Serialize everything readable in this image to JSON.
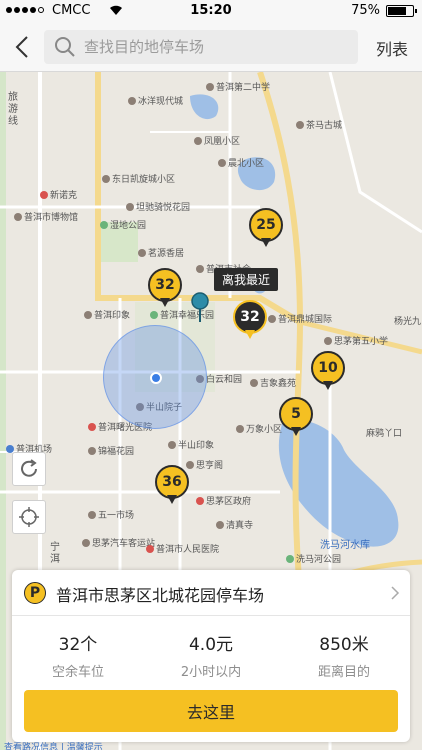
{
  "status_bar": {
    "carrier": "CMCC",
    "time": "15:20",
    "battery_percent": "75%",
    "battery_level": 0.75,
    "signal_bars": 4
  },
  "nav": {
    "search_placeholder": "查找目的地停车场",
    "list_label": "列表"
  },
  "map": {
    "road_labels": {
      "lvyou": "旅游线",
      "ning": "宁洱"
    },
    "pois": [
      {
        "name": "普洱第二中学",
        "kind": "school"
      },
      {
        "name": "冰洋现代城",
        "kind": "place"
      },
      {
        "name": "茶马古城",
        "kind": "place"
      },
      {
        "name": "凤凰小区",
        "kind": "place"
      },
      {
        "name": "晨北小区",
        "kind": "place"
      },
      {
        "name": "东日凯旋城小区",
        "kind": "place"
      },
      {
        "name": "新诺克",
        "kind": "place"
      },
      {
        "name": "坦驰骑悦花园",
        "kind": "place"
      },
      {
        "name": "普洱市博物馆",
        "kind": "place"
      },
      {
        "name": "湿地公园",
        "kind": "park"
      },
      {
        "name": "茗源香居",
        "kind": "place"
      },
      {
        "name": "普洱市社会",
        "kind": "place"
      },
      {
        "name": "普洱印象",
        "kind": "place"
      },
      {
        "name": "普洱幸福乐园",
        "kind": "park"
      },
      {
        "name": "普洱鼎城国际",
        "kind": "place"
      },
      {
        "name": "思茅第五小学",
        "kind": "school"
      },
      {
        "name": "杨光九",
        "kind": "place"
      },
      {
        "name": "白云和园",
        "kind": "place"
      },
      {
        "name": "吉象鑫苑",
        "kind": "place"
      },
      {
        "name": "半山院子",
        "kind": "place"
      },
      {
        "name": "万象小区",
        "kind": "place"
      },
      {
        "name": "麻鸦丫口",
        "kind": "road"
      },
      {
        "name": "普洱机场",
        "kind": "airport"
      },
      {
        "name": "普洱曙光医院",
        "kind": "hospital"
      },
      {
        "name": "半山印象",
        "kind": "place"
      },
      {
        "name": "锦福花园",
        "kind": "place"
      },
      {
        "name": "思亨阁",
        "kind": "place"
      },
      {
        "name": "思茅区政府",
        "kind": "gov"
      },
      {
        "name": "清真寺",
        "kind": "place"
      },
      {
        "name": "五一市场",
        "kind": "place"
      },
      {
        "name": "思茅汽车客运站",
        "kind": "place"
      },
      {
        "name": "普洱市人民医院",
        "kind": "hospital"
      },
      {
        "name": "洗马河水库",
        "kind": "water"
      },
      {
        "name": "洗马河公园",
        "kind": "park"
      }
    ],
    "markers": [
      {
        "count": "25",
        "selected": false
      },
      {
        "count": "32",
        "selected": false
      },
      {
        "count": "32",
        "selected": true
      },
      {
        "count": "10",
        "selected": false
      },
      {
        "count": "5",
        "selected": false
      },
      {
        "count": "36",
        "selected": false
      }
    ],
    "nearest_label": "离我最近"
  },
  "card": {
    "p_icon": "P",
    "lot_name": "普洱市思茅区北城花园停车场",
    "stats": [
      {
        "value": "32个",
        "label": "空余车位"
      },
      {
        "value": "4.0元",
        "label": "2小时以内"
      },
      {
        "value": "850米",
        "label": "距离目的"
      }
    ],
    "go_label": "去这里"
  },
  "bottom_strip": "查看路况信息 | 温馨提示"
}
